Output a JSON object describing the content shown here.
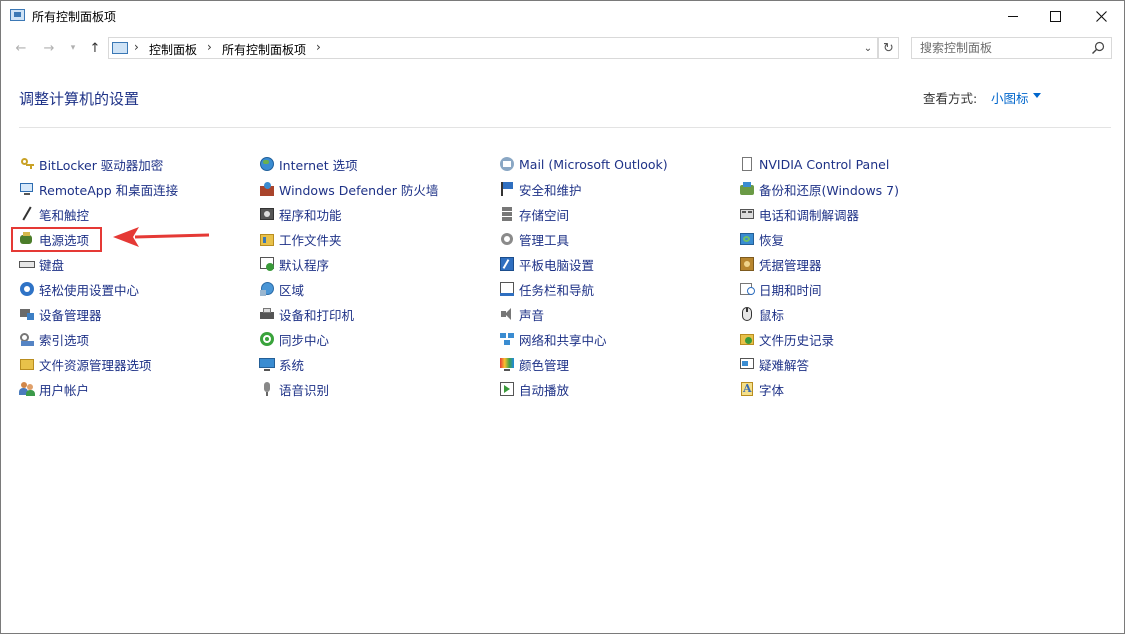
{
  "window": {
    "title": "所有控制面板项"
  },
  "address": {
    "crumbs": [
      "控制面板",
      "所有控制面板项"
    ]
  },
  "search": {
    "placeholder": "搜索控制面板"
  },
  "header": {
    "title": "调整计算机的设置",
    "view_label": "查看方式:",
    "view_value": "小图标"
  },
  "items": {
    "col1": [
      "BitLocker 驱动器加密",
      "RemoteApp 和桌面连接",
      "笔和触控",
      "电源选项",
      "键盘",
      "轻松使用设置中心",
      "设备管理器",
      "索引选项",
      "文件资源管理器选项",
      "用户帐户"
    ],
    "col2": [
      "Internet 选项",
      "Windows Defender 防火墙",
      "程序和功能",
      "工作文件夹",
      "默认程序",
      "区域",
      "设备和打印机",
      "同步中心",
      "系统",
      "语音识别"
    ],
    "col3": [
      "Mail (Microsoft Outlook)",
      "安全和维护",
      "存储空间",
      "管理工具",
      "平板电脑设置",
      "任务栏和导航",
      "声音",
      "网络和共享中心",
      "颜色管理",
      "自动播放"
    ],
    "col4": [
      "NVIDIA Control Panel",
      "备份和还原(Windows 7)",
      "电话和调制解调器",
      "恢复",
      "凭据管理器",
      "日期和时间",
      "鼠标",
      "文件历史记录",
      "疑难解答",
      "字体"
    ]
  },
  "colors": {
    "link": "#1e3287",
    "accent": "#0066cc",
    "highlight": "#e53935"
  }
}
